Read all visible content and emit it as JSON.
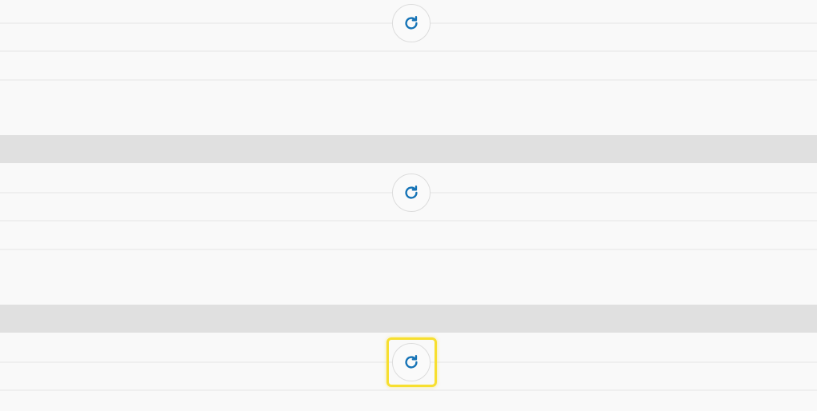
{
  "colors": {
    "background": "#f9f9f9",
    "separator": "#e0e0e0",
    "row_divider": "#efefef",
    "icon_blue": "#1573b6",
    "button_border": "#dcdcdc",
    "focus_ring": "#f7df2f"
  },
  "sections": [
    {
      "reload_button": {
        "icon": "reload-icon",
        "focused": false
      }
    },
    {
      "reload_button": {
        "icon": "reload-icon",
        "focused": false
      }
    },
    {
      "reload_button": {
        "icon": "reload-icon",
        "focused": true
      }
    }
  ]
}
